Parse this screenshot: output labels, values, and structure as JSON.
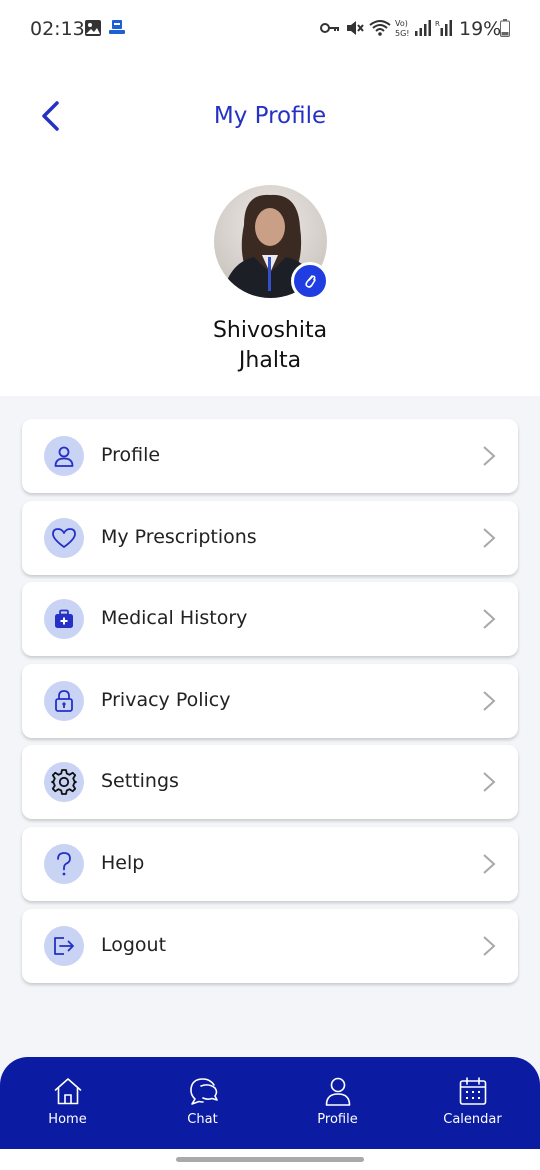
{
  "status": {
    "time": "02:13",
    "battery": "19%",
    "icons": [
      "image-icon",
      "download-icon",
      "key-icon",
      "mute-icon",
      "wifi-icon",
      "volte-icon",
      "signal-icon",
      "signal-roaming-icon",
      "battery-icon"
    ]
  },
  "header": {
    "title": "My Profile",
    "back_icon": "chevron-left-icon"
  },
  "profile": {
    "first_name": "Shivoshita",
    "last_name": "Jhalta",
    "badge_icon": "paperclip-icon"
  },
  "menu": {
    "items": [
      {
        "label": "Profile",
        "icon": "user-icon"
      },
      {
        "label": "My Prescriptions",
        "icon": "heart-icon"
      },
      {
        "label": "Medical History",
        "icon": "medical-bag-icon"
      },
      {
        "label": "Privacy Policy",
        "icon": "lock-icon"
      },
      {
        "label": "Settings",
        "icon": "gear-icon"
      },
      {
        "label": "Help",
        "icon": "question-icon"
      },
      {
        "label": "Logout",
        "icon": "logout-icon"
      }
    ]
  },
  "bottom_nav": {
    "items": [
      {
        "label": "Home",
        "icon": "home-icon"
      },
      {
        "label": "Chat",
        "icon": "chat-icon"
      },
      {
        "label": "Profile",
        "icon": "user-icon"
      },
      {
        "label": "Calendar",
        "icon": "calendar-icon"
      }
    ]
  },
  "colors": {
    "accent": "#2431c4",
    "nav_background": "#0c1ca2",
    "icon_circle": "#c9d3f4",
    "badge": "#1f3de0",
    "page_background": "#f4f5f9"
  }
}
